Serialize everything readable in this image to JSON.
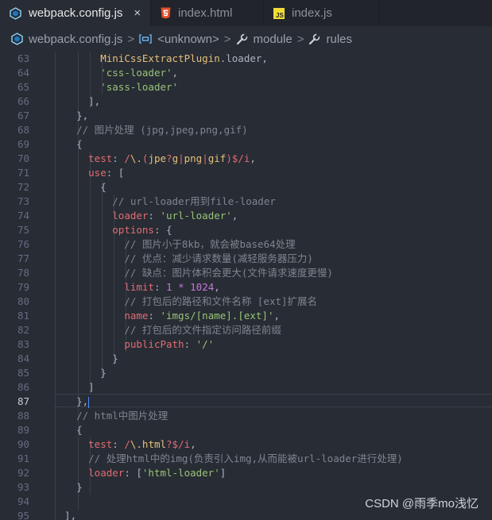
{
  "tabs": [
    {
      "label": "webpack.config.js",
      "icon": "webpack-cube-icon",
      "active": true,
      "close": "×"
    },
    {
      "label": "index.html",
      "icon": "html5-icon",
      "active": false
    },
    {
      "label": "index.js",
      "icon": "javascript-icon",
      "active": false
    }
  ],
  "breadcrumbs": [
    {
      "label": "webpack.config.js",
      "icon": "webpack-cube-icon"
    },
    {
      "label": "<unknown>",
      "icon": "symbol-variable-icon"
    },
    {
      "label": "module",
      "icon": "wrench-icon"
    },
    {
      "label": "rules",
      "icon": "wrench-icon"
    }
  ],
  "breadcrumb_separator": ">",
  "current_line": 87,
  "lines": [
    {
      "n": "63",
      "tokens": [
        [
          "",
          "        "
        ],
        [
          "t-fn",
          "MiniCssExtractPlugin"
        ],
        [
          "",
          ".loader,"
        ]
      ]
    },
    {
      "n": "64",
      "tokens": [
        [
          "",
          "        "
        ],
        [
          "t-str",
          "'css-loader'"
        ],
        [
          "",
          ","
        ]
      ]
    },
    {
      "n": "65",
      "tokens": [
        [
          "",
          "        "
        ],
        [
          "t-str",
          "'sass-loader'"
        ]
      ]
    },
    {
      "n": "66",
      "tokens": [
        [
          "",
          "      ],"
        ]
      ]
    },
    {
      "n": "67",
      "tokens": [
        [
          "",
          "    },"
        ]
      ]
    },
    {
      "n": "68",
      "tokens": [
        [
          "t-cm",
          "    // 图片处理 (jpg,jpeg,png,gif)"
        ]
      ]
    },
    {
      "n": "69",
      "tokens": [
        [
          "",
          "    {"
        ]
      ]
    },
    {
      "n": "70",
      "tokens": [
        [
          "",
          "      "
        ],
        [
          "t-kw",
          "test"
        ],
        [
          "",
          ": "
        ],
        [
          "t-kw",
          "/"
        ],
        [
          "t-re",
          "\\."
        ],
        [
          "t-kw",
          "("
        ],
        [
          "t-fn",
          "jpe"
        ],
        [
          "t-kw",
          "?"
        ],
        [
          "t-fn",
          "g"
        ],
        [
          "t-kw",
          "|"
        ],
        [
          "t-fn",
          "png"
        ],
        [
          "t-kw",
          "|"
        ],
        [
          "t-fn",
          "gif"
        ],
        [
          "t-kw",
          ")$/i"
        ],
        [
          "",
          ","
        ]
      ]
    },
    {
      "n": "71",
      "tokens": [
        [
          "",
          "      "
        ],
        [
          "t-kw",
          "use"
        ],
        [
          "",
          ": ["
        ]
      ]
    },
    {
      "n": "72",
      "tokens": [
        [
          "",
          "        {"
        ]
      ]
    },
    {
      "n": "73",
      "tokens": [
        [
          "t-cm",
          "          // url-loader用到file-loader"
        ]
      ]
    },
    {
      "n": "74",
      "tokens": [
        [
          "",
          "          "
        ],
        [
          "t-kw",
          "loader"
        ],
        [
          "",
          ": "
        ],
        [
          "t-str",
          "'url-loader'"
        ],
        [
          "",
          ","
        ]
      ]
    },
    {
      "n": "75",
      "tokens": [
        [
          "",
          "          "
        ],
        [
          "t-kw",
          "options"
        ],
        [
          "",
          ": {"
        ]
      ]
    },
    {
      "n": "76",
      "tokens": [
        [
          "t-cm",
          "            // 图片小于8kb，就会被base64处理"
        ]
      ]
    },
    {
      "n": "77",
      "tokens": [
        [
          "t-cm",
          "            // 优点：减少请求数量(减轻服务器压力)"
        ]
      ]
    },
    {
      "n": "78",
      "tokens": [
        [
          "t-cm",
          "            // 缺点：图片体积会更大(文件请求速度更慢)"
        ]
      ]
    },
    {
      "n": "79",
      "tokens": [
        [
          "",
          "            "
        ],
        [
          "t-kw",
          "limit"
        ],
        [
          "",
          ": "
        ],
        [
          "t-num2",
          "1"
        ],
        [
          "",
          " "
        ],
        [
          "t-op",
          "*"
        ],
        [
          "",
          " "
        ],
        [
          "t-num2",
          "1024"
        ],
        [
          "",
          ","
        ]
      ]
    },
    {
      "n": "80",
      "tokens": [
        [
          "t-cm",
          "            // 打包后的路径和文件名称 [ext]扩展名"
        ]
      ]
    },
    {
      "n": "81",
      "tokens": [
        [
          "",
          "            "
        ],
        [
          "t-kw",
          "name"
        ],
        [
          "",
          ": "
        ],
        [
          "t-str",
          "'imgs/[name].[ext]'"
        ],
        [
          "",
          ","
        ]
      ]
    },
    {
      "n": "82",
      "tokens": [
        [
          "t-cm",
          "            // 打包后的文件指定访问路径前缀"
        ]
      ]
    },
    {
      "n": "83",
      "tokens": [
        [
          "",
          "            "
        ],
        [
          "t-kw",
          "publicPath"
        ],
        [
          "",
          ": "
        ],
        [
          "t-str",
          "'/'"
        ]
      ]
    },
    {
      "n": "84",
      "tokens": [
        [
          "",
          "          }"
        ]
      ]
    },
    {
      "n": "85",
      "tokens": [
        [
          "",
          "        }"
        ]
      ]
    },
    {
      "n": "86",
      "tokens": [
        [
          "",
          "      ]"
        ]
      ]
    },
    {
      "n": "87",
      "tokens": [
        [
          "",
          "    },"
        ]
      ]
    },
    {
      "n": "88",
      "tokens": [
        [
          "t-cm",
          "    // html中图片处理"
        ]
      ]
    },
    {
      "n": "89",
      "tokens": [
        [
          "",
          "    {"
        ]
      ]
    },
    {
      "n": "90",
      "tokens": [
        [
          "",
          "      "
        ],
        [
          "t-kw",
          "test"
        ],
        [
          "",
          ": "
        ],
        [
          "t-kw",
          "/"
        ],
        [
          "t-re",
          "\\."
        ],
        [
          "t-fn",
          "html"
        ],
        [
          "t-kw",
          "?$/i"
        ],
        [
          "",
          ","
        ]
      ]
    },
    {
      "n": "91",
      "tokens": [
        [
          "t-cm",
          "      // 处理html中的img(负责引入img,从而能被url-loader进行处理)"
        ]
      ]
    },
    {
      "n": "92",
      "tokens": [
        [
          "",
          "      "
        ],
        [
          "t-kw",
          "loader"
        ],
        [
          "",
          ": ["
        ],
        [
          "t-str",
          "'html-loader'"
        ],
        [
          "",
          "]"
        ]
      ]
    },
    {
      "n": "93",
      "tokens": [
        [
          "",
          "    }"
        ]
      ]
    },
    {
      "n": "94",
      "tokens": [
        [
          "",
          ""
        ]
      ]
    },
    {
      "n": "95",
      "tokens": [
        [
          "",
          "  ],"
        ]
      ]
    }
  ],
  "watermark": "CSDN @雨季mo浅忆",
  "colors": {
    "background": "#282c34",
    "tabbar": "#21252b",
    "keyword": "#e06c75",
    "string": "#98c379",
    "comment": "#7f848e",
    "class": "#e5c07b",
    "number": "#c678dd"
  }
}
